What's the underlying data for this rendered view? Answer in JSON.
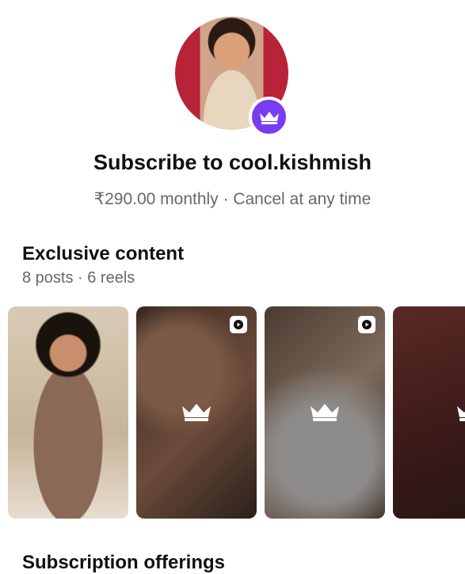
{
  "header": {
    "title": "Subscribe to cool.kishmish",
    "price_line": "₹290.00 monthly · Cancel at any time"
  },
  "exclusive": {
    "title": "Exclusive content",
    "subtitle": "8 posts · 6 reels",
    "items": [
      {
        "type": "photo",
        "locked": false
      },
      {
        "type": "reel",
        "locked": true,
        "icon": "play-icon"
      },
      {
        "type": "reel",
        "locked": true,
        "icon": "play-icon"
      },
      {
        "type": "photo",
        "locked": true
      }
    ]
  },
  "offerings": {
    "title": "Subscription offerings"
  },
  "colors": {
    "accent": "#7a3cf0",
    "muted_text": "#65676b"
  }
}
